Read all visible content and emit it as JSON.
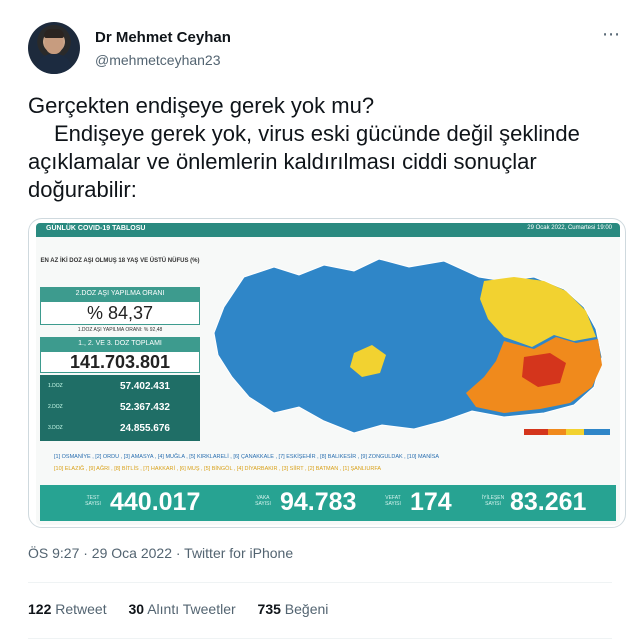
{
  "author": {
    "name": "Dr Mehmet Ceyhan",
    "handle": "@mehmetceyhan23"
  },
  "tweet": {
    "line1": "Gerçekten endişeye gerek yok mu?",
    "line2": "Endişeye gerek yok, virus eski gücünde değil şeklinde açıklamalar ve önlemlerin kaldırılması ciddi sonuçlar doğurabilir:"
  },
  "more_icon": "⋯",
  "media": {
    "title": "GÜNLÜK COVID-19 TABLOSU",
    "date": "29 Ocak 2022, Cumartesi 19:00",
    "vax_header": "EN AZ İKİ DOZ AŞI OLMUŞ 18 YAŞ VE ÜSTÜ NÜFUS (%)",
    "dose2_label": "2.DOZ AŞI YAPILMA ORANI",
    "dose2_value": "% 84,37",
    "dose1_note": "1.DOZ AŞI YAPILMA ORANI: % 92,48",
    "total_label": "1., 2. VE 3. DOZ TOPLAMI",
    "total_value": "141.703.801",
    "doses": [
      {
        "label": "1.DOZ",
        "value": "57.402.431"
      },
      {
        "label": "2.DOZ",
        "value": "52.367.432"
      },
      {
        "label": "3.DOZ",
        "value": "24.855.676"
      }
    ],
    "cities_blue": "[1] OSMANİYE , [2] ORDU , [3] AMASYA , [4] MUĞLA , [5] KIRKLARELİ , [6] ÇANAKKALE , [7] ESKİŞEHİR , [8] BALIKESİR , [9] ZONGULDAK , [10] MANİSA",
    "cities_orange": "[10] ELAZIĞ , [9] AĞRI , [8] BİTLİS , [7] HAKKARİ , [6] MUŞ , [5] BİNGÖL , [4] DİYARBAKIR , [3] SİİRT , [2] BATMAN , [1] ŞANLIURFA",
    "stats": [
      {
        "label": "TEST SAYISI",
        "value": "440.017"
      },
      {
        "label": "VAKA SAYISI",
        "value": "94.783"
      },
      {
        "label": "VEFAT SAYISI",
        "value": "174"
      },
      {
        "label": "İYİLEŞEN SAYISI",
        "value": "83.261"
      }
    ],
    "colors": {
      "teal": "#27a392",
      "map_blue": "#2f86c8",
      "map_yellow": "#f2d230",
      "map_orange": "#f08a1c",
      "map_red": "#d4351c"
    }
  },
  "meta": {
    "time": "ÖS 9:27 · 29 Oca 2022 · Twitter for iPhone"
  },
  "engagement": {
    "retweets": "122",
    "retweets_label": "Retweet",
    "quotes": "30",
    "quotes_label": "Alıntı Tweetler",
    "likes": "735",
    "likes_label": "Beğeni"
  }
}
